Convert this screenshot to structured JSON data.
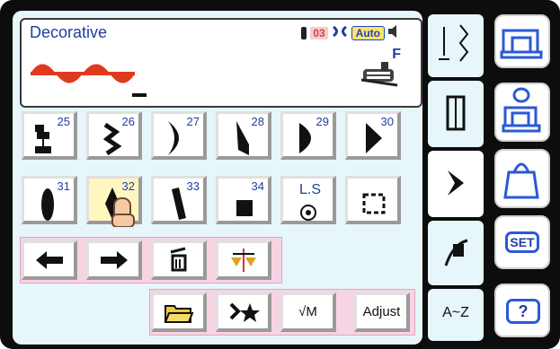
{
  "display": {
    "title": "Decorative",
    "tension": "03",
    "auto_label": "Auto",
    "foot_letter": "F"
  },
  "stitch_keys": [
    {
      "number": "25",
      "icon": "stitch-25-icon"
    },
    {
      "number": "26",
      "icon": "stitch-26-icon"
    },
    {
      "number": "27",
      "icon": "stitch-27-icon"
    },
    {
      "number": "28",
      "icon": "stitch-28-icon"
    },
    {
      "number": "29",
      "icon": "stitch-29-icon"
    },
    {
      "number": "30",
      "icon": "stitch-30-icon"
    },
    {
      "number": "31",
      "icon": "stitch-31-icon"
    },
    {
      "number": "32",
      "icon": "stitch-32-icon",
      "selected": true
    },
    {
      "number": "33",
      "icon": "stitch-33-icon"
    },
    {
      "number": "34",
      "icon": "stitch-34-icon"
    }
  ],
  "lock_stitch_label": "L.S",
  "function_keys": {
    "adjust_label": "Adjust",
    "memory_label": "√M"
  },
  "tabs": {
    "alphabet_label": "A~Z"
  },
  "side_buttons": {
    "set_label": "SET",
    "help_label": "?"
  },
  "colors": {
    "accent_blue": "#1f3f9f",
    "stitch_red": "#e03a1e",
    "selected_key": "#fff7c0",
    "auto_badge": "#ffe36a",
    "function_row": "#f6d4e3",
    "panel_bg": "#e6f6fb"
  }
}
